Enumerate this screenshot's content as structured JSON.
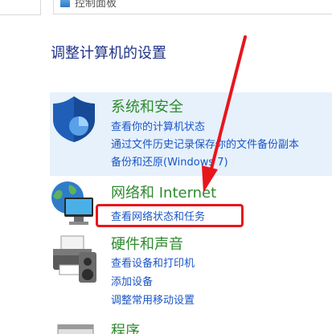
{
  "address_bar": {
    "breadcrumb": "控制面板"
  },
  "page_title": "调整计算机的设置",
  "categories": [
    {
      "title": "系统和安全",
      "icon": "shield-icon",
      "links": [
        "查看你的计算机状态",
        "通过文件历史记录保存你的文件备份副本",
        "备份和还原(Windows 7)"
      ]
    },
    {
      "title": "网络和 Internet",
      "icon": "network-globe-icon",
      "links": [
        "查看网络状态和任务"
      ]
    },
    {
      "title": "硬件和声音",
      "icon": "printer-icon",
      "links": [
        "查看设备和打印机",
        "添加设备",
        "调整常用移动设置"
      ]
    },
    {
      "title": "程序",
      "icon": "programs-icon",
      "links": []
    }
  ],
  "annotation": {
    "color": "#e8161d",
    "target": "查看网络状态和任务"
  }
}
